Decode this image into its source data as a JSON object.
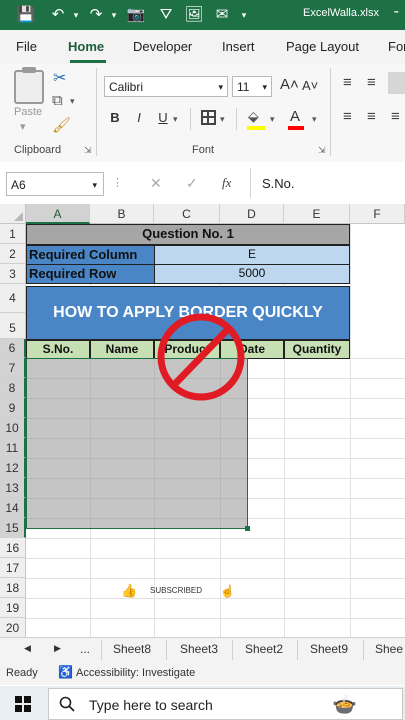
{
  "window": {
    "filename": "ExcelWalla.xlsx",
    "title_dash": "-"
  },
  "quick_access": {
    "save": "💾",
    "undo": "↶",
    "redo": "↷",
    "camera": "📷",
    "filter": "⛛",
    "image": "🖼",
    "mail": "✉"
  },
  "tabs": [
    "File",
    "Home",
    "Developer",
    "Insert",
    "Page Layout",
    "For"
  ],
  "ribbon": {
    "paste_label": "Paste",
    "clipboard_label": "Clipboard",
    "font_label": "Font",
    "font_name": "Calibri",
    "font_size": "11",
    "grow_font": "A˄",
    "shrink_font": "A˅",
    "bold": "B",
    "italic": "I",
    "underline": "U",
    "font_color": "A"
  },
  "formula_bar": {
    "name_box": "A6",
    "cancel": "✕",
    "enter": "✓",
    "fx": "fx",
    "content": "S.No."
  },
  "columns": [
    "A",
    "B",
    "C",
    "D",
    "E",
    "F"
  ],
  "rows": [
    "1",
    "2",
    "3",
    "4",
    "5",
    "6",
    "7",
    "8",
    "9",
    "10",
    "11",
    "12",
    "13",
    "14",
    "15",
    "16",
    "17",
    "18",
    "19",
    "20"
  ],
  "sheet": {
    "title": "Question No. 1",
    "required_column_label": "Required Column",
    "required_column_value": "E",
    "required_row_label": "Required Row",
    "required_row_value": "5000",
    "banner": "HOW TO APPLY BORDER QUICKLY",
    "headers": [
      "S.No.",
      "Name",
      "Product",
      "Date",
      "Quantity"
    ]
  },
  "overlay": {
    "subscribed": "SUBSCRIBED",
    "no_symbol_color": "#e01b24"
  },
  "sheet_tabs": {
    "more": "...",
    "tabs": [
      "Sheet8",
      "Sheet3",
      "Sheet2",
      "Sheet9",
      "Shee"
    ]
  },
  "status": {
    "ready": "Ready",
    "accessibility": "Accessibility: Investigate"
  },
  "taskbar": {
    "search_placeholder": "Type here to search"
  },
  "colors": {
    "excel_green": "#1e7145",
    "header_fill": "#a6a6a6",
    "blue_fill": "#4a86c6",
    "light_blue": "#bdd7ee",
    "green_header": "#c6e0b4"
  }
}
